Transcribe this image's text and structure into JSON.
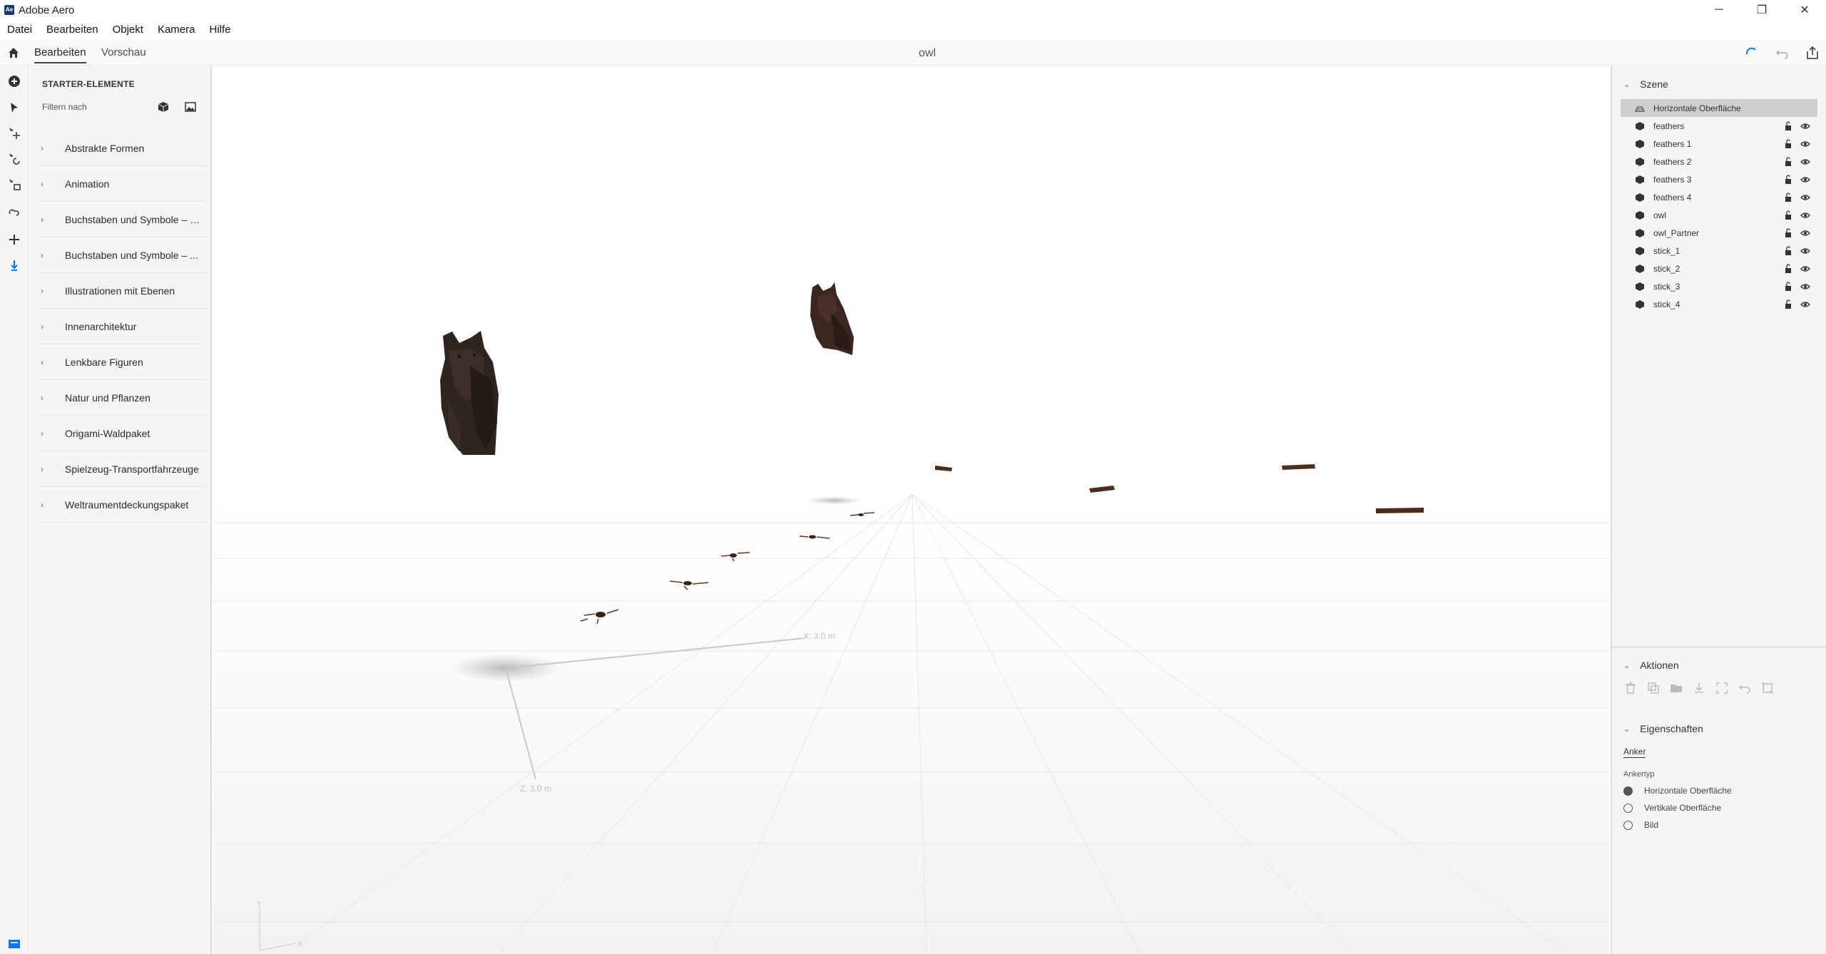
{
  "window": {
    "title": "Adobe Aero",
    "icon_text": "Ae"
  },
  "menu": [
    "Datei",
    "Bearbeiten",
    "Objekt",
    "Kamera",
    "Hilfe"
  ],
  "tabs": {
    "edit": "Bearbeiten",
    "preview": "Vorschau"
  },
  "document_title": "owl",
  "starter": {
    "title": "STARTER-ELEMENTE",
    "filter_placeholder": "Filtern nach",
    "categories": [
      "Abstrakte Formen",
      "Animation",
      "Buchstaben und Symbole – e...",
      "Buchstaben und Symbole – ...",
      "Illustrationen mit Ebenen",
      "Innenarchitektur",
      "Lenkbare Figuren",
      "Natur und Pflanzen",
      "Origami-Waldpaket",
      "Spielzeug-Transportfahrzeuge",
      "Weltraumentdeckungspaket"
    ]
  },
  "viewport": {
    "x_axis_label": "X: 3,0 m",
    "z_axis_label": "Z: 3,0 m",
    "gizmo_y": "Y",
    "gizmo_x": "X"
  },
  "scene": {
    "title": "Szene",
    "anchor_row": "Horizontale Oberfläche",
    "layers": [
      "feathers",
      "feathers 1",
      "feathers 2",
      "feathers 3",
      "feathers 4",
      "owl",
      "owl_Partner",
      "stick_1",
      "stick_2",
      "stick_3",
      "stick_4"
    ]
  },
  "actions": {
    "title": "Aktionen"
  },
  "properties": {
    "title": "Eigenschaften",
    "tab": "Anker",
    "anchor_type_label": "Ankertyp",
    "options": [
      "Horizontale Oberfläche",
      "Vertikale Oberfläche",
      "Bild"
    ],
    "selected_option": "Horizontale Oberfläche"
  },
  "colors": {
    "accent": "#1473e6",
    "owl": "#3b2a22",
    "stick": "#4a2e20"
  }
}
